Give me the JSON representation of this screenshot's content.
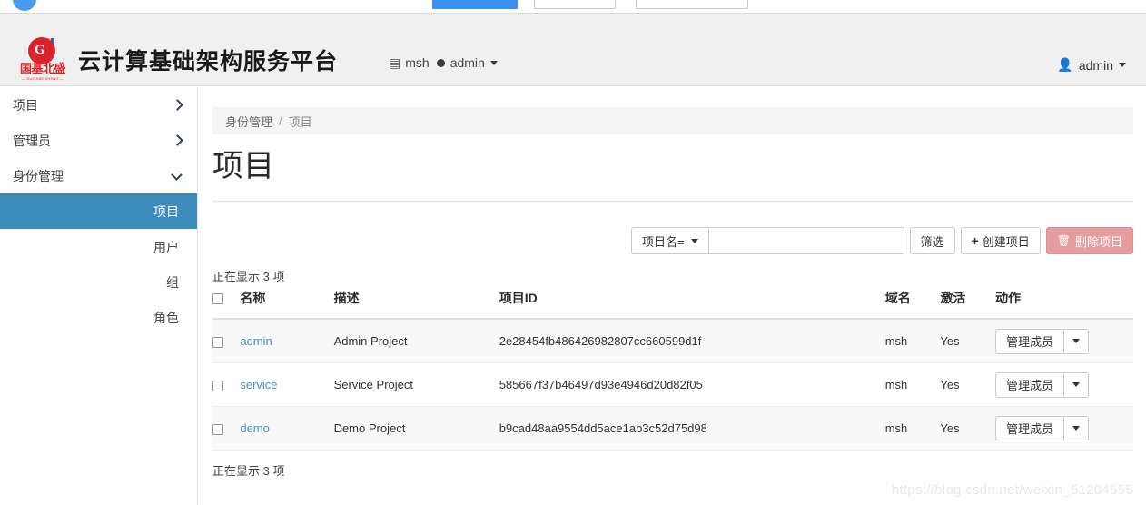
{
  "browser_strip": {
    "circle_icon": "blue-circle-icon",
    "blue_button": "",
    "white_button_a": "",
    "white_button_b": ""
  },
  "header": {
    "logo": {
      "icon": "company-logo-icon",
      "mark_letter": "G",
      "chinese_name": "国基北盛",
      "english_name": "— GUOJIBEISHENG —"
    },
    "platform_title": "云计算基础架构服务平台",
    "context": {
      "domain_icon": "building-icon",
      "domain_label": "msh",
      "project_dot_icon": "circle-dot-icon",
      "project_label": "admin",
      "caret_icon": "caret-down-icon"
    },
    "user": {
      "icon": "user-icon",
      "label": "admin",
      "caret_icon": "caret-down-icon"
    }
  },
  "sidebar": {
    "groups": [
      {
        "label": "项目",
        "expanded": false,
        "chevron_icon": "chevron-right-icon"
      },
      {
        "label": "管理员",
        "expanded": false,
        "chevron_icon": "chevron-right-icon"
      },
      {
        "label": "身份管理",
        "expanded": true,
        "chevron_icon": "chevron-down-icon"
      }
    ],
    "subitems": [
      {
        "label": "项目",
        "active": true
      },
      {
        "label": "用户",
        "active": false
      },
      {
        "label": "组",
        "active": false
      },
      {
        "label": "角色",
        "active": false
      }
    ]
  },
  "main": {
    "breadcrumb": {
      "parent": "身份管理",
      "separator": "/",
      "current": "项目"
    },
    "page_title": "项目",
    "toolbar": {
      "filter_field_label": "项目名=",
      "filter_field_caret_icon": "caret-down-icon",
      "search_value": "",
      "search_placeholder": "",
      "filter_button": "筛选",
      "create_button": "创建项目",
      "create_icon": "plus-icon",
      "delete_button": "删除项目",
      "delete_icon": "trash-icon",
      "delete_color": "#e59ea0"
    },
    "count_top": "正在显示 3 项",
    "count_bottom": "正在显示 3 项",
    "table": {
      "select_all_checkbox": "",
      "headers": [
        "名称",
        "描述",
        "项目ID",
        "域名",
        "激活",
        "动作"
      ],
      "rows": [
        {
          "name": "admin",
          "description": "Admin Project",
          "project_id": "2e28454fb486426982807cc660599d1f",
          "domain": "msh",
          "enabled": "Yes",
          "action_label": "管理成员",
          "action_caret_icon": "caret-down-icon"
        },
        {
          "name": "service",
          "description": "Service Project",
          "project_id": "585667f37b46497d93e4946d20d82f05",
          "domain": "msh",
          "enabled": "Yes",
          "action_label": "管理成员",
          "action_caret_icon": "caret-down-icon"
        },
        {
          "name": "demo",
          "description": "Demo Project",
          "project_id": "b9cad48aa9554dd5ace1ab3c52d75d98",
          "domain": "msh",
          "enabled": "Yes",
          "action_label": "管理成员",
          "action_caret_icon": "caret-down-icon"
        }
      ]
    }
  },
  "watermark": "https://blog.csdn.net/weixin_51204555",
  "colors": {
    "accent_blue": "#3c8dbc",
    "link_blue": "#4a8fc0",
    "brand_red": "#d8232a",
    "danger": "#e59ea0",
    "header_bg": "#f0f0f0"
  }
}
